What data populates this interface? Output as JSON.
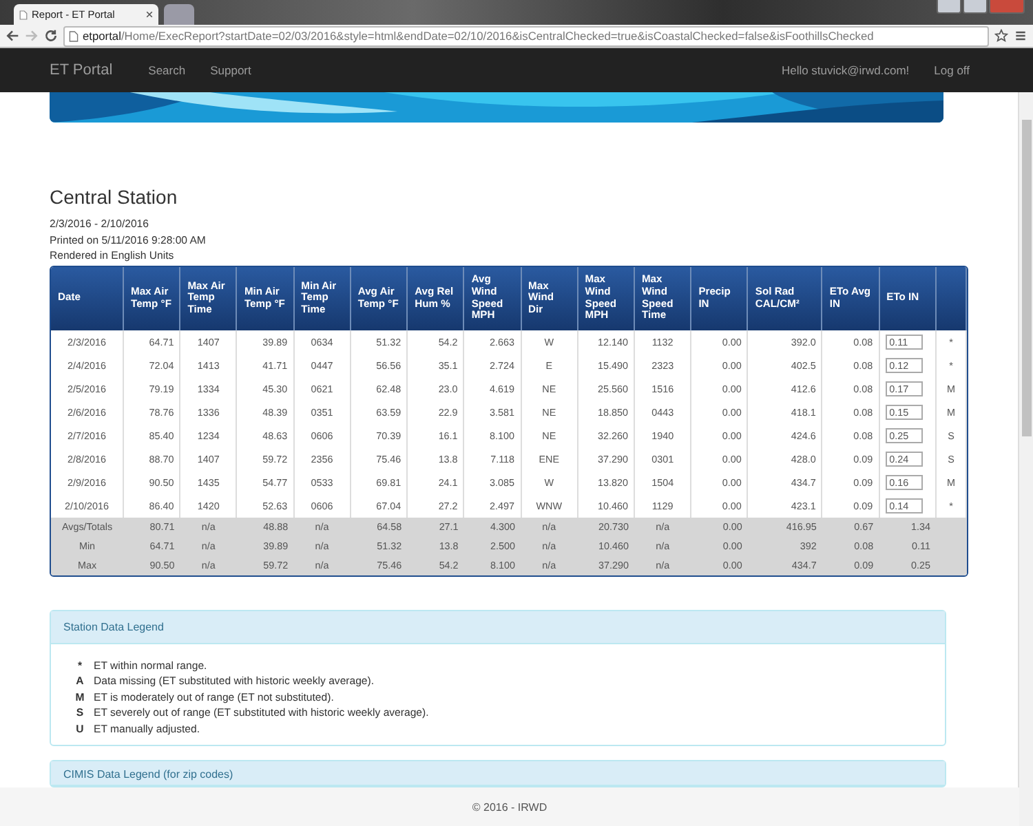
{
  "browser": {
    "tabs": [
      {
        "title": "Report - ET Portal",
        "selected": true
      },
      {
        "selected": false
      }
    ],
    "address": {
      "host": "etportal",
      "path": "/Home/ExecReport?startDate=02/03/2016&style=html&endDate=02/10/2016&isCentralChecked=true&isCoastalChecked=false&isFoothillsChecked"
    }
  },
  "navbar": {
    "brand": "ET Portal",
    "links": [
      "Search",
      "Support"
    ],
    "user": "Hello stuvick@irwd.com!",
    "logout": "Log off"
  },
  "report": {
    "title": "Central Station",
    "lines": [
      "2/3/2016 - 2/10/2016",
      "Printed on 5/11/2016 9:28:00 AM",
      "Rendered in English Units"
    ],
    "table": {
      "columns": [
        "Date",
        "Max Air Temp °F",
        "Max Air Temp Time",
        "Min Air Temp °F",
        "Min Air Temp Time",
        "Avg Air Temp °F",
        "Avg Rel Hum %",
        "Avg Wind Speed MPH",
        "Max Wind Dir",
        "Max Wind Speed MPH",
        "Max Wind Speed Time",
        "Precip IN",
        "Sol Rad CAL/CM²",
        "ETo Avg IN",
        "ETo IN"
      ],
      "rows": [
        {
          "cells": [
            "2/3/2016",
            "64.71",
            "1407",
            "39.89",
            "0634",
            "51.32",
            "54.2",
            "2.663",
            "W",
            "12.140",
            "1132",
            "0.00",
            "392.0",
            "0.08"
          ],
          "eto": "0.11",
          "flag": "*"
        },
        {
          "cells": [
            "2/4/2016",
            "72.04",
            "1413",
            "41.71",
            "0447",
            "56.56",
            "35.1",
            "2.724",
            "E",
            "15.490",
            "2323",
            "0.00",
            "402.5",
            "0.08"
          ],
          "eto": "0.12",
          "flag": "*"
        },
        {
          "cells": [
            "2/5/2016",
            "79.19",
            "1334",
            "45.30",
            "0621",
            "62.48",
            "23.0",
            "4.619",
            "NE",
            "25.560",
            "1516",
            "0.00",
            "412.6",
            "0.08"
          ],
          "eto": "0.17",
          "flag": "M"
        },
        {
          "cells": [
            "2/6/2016",
            "78.76",
            "1336",
            "48.39",
            "0351",
            "63.59",
            "22.9",
            "3.581",
            "NE",
            "18.850",
            "0443",
            "0.00",
            "418.1",
            "0.08"
          ],
          "eto": "0.15",
          "flag": "M"
        },
        {
          "cells": [
            "2/7/2016",
            "85.40",
            "1234",
            "48.63",
            "0606",
            "70.39",
            "16.1",
            "8.100",
            "NE",
            "32.260",
            "1940",
            "0.00",
            "424.6",
            "0.08"
          ],
          "eto": "0.25",
          "flag": "S"
        },
        {
          "cells": [
            "2/8/2016",
            "88.70",
            "1407",
            "59.72",
            "2356",
            "75.46",
            "13.8",
            "7.118",
            "ENE",
            "37.290",
            "0301",
            "0.00",
            "428.0",
            "0.09"
          ],
          "eto": "0.24",
          "flag": "S"
        },
        {
          "cells": [
            "2/9/2016",
            "90.50",
            "1435",
            "54.77",
            "0533",
            "69.81",
            "24.1",
            "3.085",
            "W",
            "13.820",
            "1504",
            "0.00",
            "434.7",
            "0.09"
          ],
          "eto": "0.16",
          "flag": "M"
        },
        {
          "cells": [
            "2/10/2016",
            "86.40",
            "1420",
            "52.63",
            "0606",
            "67.04",
            "27.2",
            "2.497",
            "WNW",
            "10.460",
            "1129",
            "0.00",
            "423.1",
            "0.09"
          ],
          "eto": "0.14",
          "flag": "*"
        }
      ],
      "summary": [
        {
          "cells": [
            "Avgs/Totals",
            "80.71",
            "n/a",
            "48.88",
            "n/a",
            "64.58",
            "27.1",
            "4.300",
            "n/a",
            "20.730",
            "n/a",
            "0.00",
            "416.95",
            "0.67",
            "1.34"
          ]
        },
        {
          "cells": [
            "Min",
            "64.71",
            "n/a",
            "39.89",
            "n/a",
            "51.32",
            "13.8",
            "2.500",
            "n/a",
            "10.460",
            "n/a",
            "0.00",
            "392",
            "0.08",
            "0.11"
          ]
        },
        {
          "cells": [
            "Max",
            "90.50",
            "n/a",
            "59.72",
            "n/a",
            "75.46",
            "54.2",
            "8.100",
            "n/a",
            "37.290",
            "n/a",
            "0.00",
            "434.7",
            "0.09",
            "0.25"
          ]
        }
      ]
    }
  },
  "legend": {
    "title": "Station Data Legend",
    "items": [
      {
        "code": "*",
        "text": "ET within normal range."
      },
      {
        "code": "A",
        "text": "Data missing (ET substituted with historic weekly average)."
      },
      {
        "code": "M",
        "text": "ET is moderately out of range (ET not substituted)."
      },
      {
        "code": "S",
        "text": "ET severely out of range (ET substituted with historic weekly average)."
      },
      {
        "code": "U",
        "text": "ET manually adjusted."
      }
    ]
  },
  "cimis_legend": {
    "title": "CIMIS Data Legend (for zip codes)"
  },
  "footer": "© 2016 - IRWD"
}
